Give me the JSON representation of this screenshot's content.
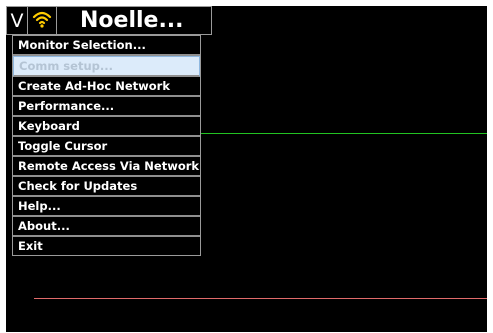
{
  "topbar": {
    "v_label": "V",
    "wifi_icon": "wifi-signal-icon",
    "wifi_color": "#ffcc00",
    "device_name": "Noelle..."
  },
  "menu": {
    "items": [
      {
        "label": "Monitor Selection...",
        "disabled": false
      },
      {
        "label": "Comm setup...",
        "disabled": true
      },
      {
        "label": "Create Ad-Hoc Network",
        "disabled": false
      },
      {
        "label": "Performance...",
        "disabled": false
      },
      {
        "label": "Keyboard",
        "disabled": false
      },
      {
        "label": "Toggle Cursor",
        "disabled": false
      },
      {
        "label": "Remote Access Via Network",
        "disabled": false
      },
      {
        "label": "Check for Updates",
        "disabled": false
      },
      {
        "label": "Help...",
        "disabled": false
      },
      {
        "label": "About...",
        "disabled": false
      },
      {
        "label": "Exit",
        "disabled": false
      }
    ]
  },
  "traces": {
    "green_color": "#22c322",
    "red_color": "#e06a6a"
  }
}
